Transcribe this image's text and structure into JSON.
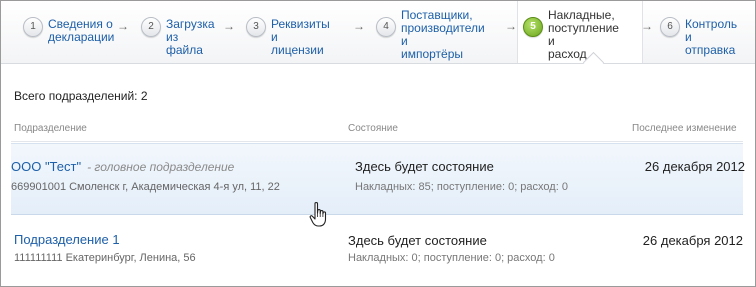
{
  "steps": [
    {
      "number": "1",
      "label": "Сведения о\nдекларации",
      "active": false
    },
    {
      "number": "2",
      "label": "Загрузка\nиз файла",
      "active": false
    },
    {
      "number": "3",
      "label": "Реквизиты и\nлицензии",
      "active": false
    },
    {
      "number": "4",
      "label": "Поставщики,\nпроизводители и\nимпортёры",
      "active": false
    },
    {
      "number": "5",
      "label": "Накладные,\nпоступление и\nрасход",
      "active": true
    },
    {
      "number": "6",
      "label": "Контроль и\nотправка",
      "active": false
    }
  ],
  "arrow_glyph": "→",
  "summary": {
    "total_label": "Всего подразделений: 2"
  },
  "table": {
    "headers": {
      "division": "Подразделение",
      "state": "Состояние",
      "last_change": "Последнее изменение"
    },
    "rows": [
      {
        "name": "ООО \"Тест\"",
        "suffix": "- головное подразделение",
        "address": "669901001 Смоленск г, Академическая 4-я ул, 11, 22",
        "state": "Здесь будет состояние",
        "counts": "Накладных: 85; поступление: 0; расход: 0",
        "date": "26 декабря 2012",
        "hovered": true
      },
      {
        "name": "Подразделение 1",
        "suffix": "",
        "address": "111111111 Екатеринбург, Ленина, 56",
        "state": "Здесь будет состояние",
        "counts": "Накладных: 0; поступление: 0; расход: 0",
        "date": "26 декабря 2012",
        "hovered": false
      }
    ]
  },
  "colors": {
    "link": "#1d5fa8",
    "active_step": "#6aa51b",
    "hover_row": "#e4eef9"
  },
  "icons": {
    "cursor": "hand-pointer-icon"
  }
}
